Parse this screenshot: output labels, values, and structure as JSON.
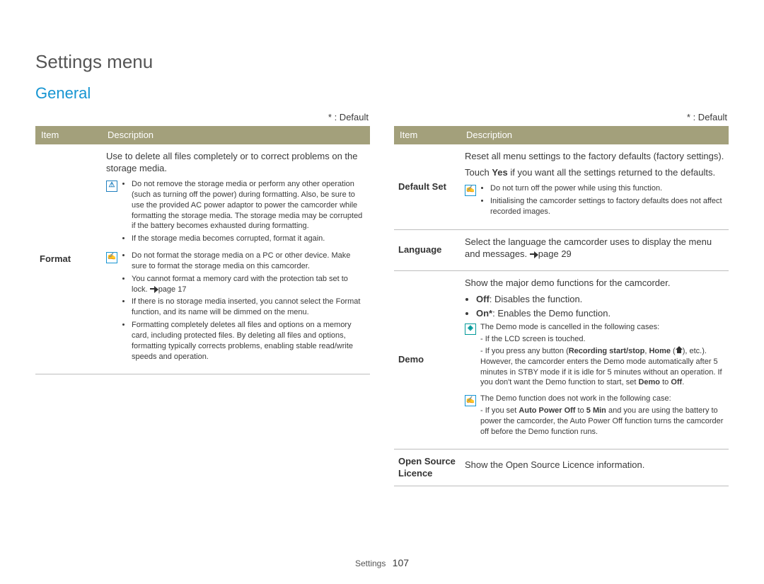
{
  "pageTitle": "Settings menu",
  "sectionHeading": "General",
  "defaultNote": "* : Default",
  "tableHeaders": {
    "item": "Item",
    "description": "Description"
  },
  "left": {
    "format": {
      "label": "Format",
      "intro": "Use to delete all files completely or to correct problems on the storage media.",
      "note1": {
        "b1": "Do not remove the storage media or perform any other operation (such as turning off the power) during formatting. Also, be sure to use the provided AC power adaptor to power the camcorder while formatting the storage media. The storage media may be corrupted if the battery becomes exhausted during formatting.",
        "b2": "If the storage media becomes corrupted, format it again."
      },
      "note2": {
        "b1": "Do not format the storage media on a PC or other device. Make sure to format the storage media on this camcorder.",
        "b2_pre": "You cannot format a memory card with the protection tab set to lock. ",
        "b2_page": "page 17",
        "b3": "If there is no storage media inserted, you cannot select the Format function, and its name will be dimmed on the menu.",
        "b4": "Formatting completely deletes all files and options on a memory card, including protected files. By deleting all files and options, formatting typically corrects problems, enabling stable read/write speeds and operation."
      }
    }
  },
  "right": {
    "defaultSet": {
      "label": "Default Set",
      "p1": "Reset all menu settings to the factory defaults (factory settings).",
      "p2_pre": "Touch ",
      "p2_b": "Yes",
      "p2_post": " if you want all the settings returned to the defaults.",
      "note": {
        "b1": "Do not turn off the power while using this function.",
        "b2": "Initialising the camcorder settings to factory defaults does not affect recorded images."
      }
    },
    "language": {
      "label": "Language",
      "text_pre": "Select the language the camcorder uses to display the menu and messages. ",
      "text_page": "page 29"
    },
    "demo": {
      "label": "Demo",
      "intro": "Show the major demo functions for the camcorder.",
      "off_b": "Off",
      "off_rest": ": Disables the function.",
      "on_b": "On*",
      "on_rest": ": Enables the Demo function.",
      "note1": {
        "l1": "The Demo mode is cancelled in the following cases:",
        "l2": "- If the LCD screen is touched.",
        "l3_pre": "- If you press any button (",
        "l3_b1": "Recording start/stop",
        "l3_mid": ", ",
        "l3_b2": "Home",
        "l3_post1": " (",
        "l3_post2": "), etc.). However, the camcorder enters the Demo mode automatically after 5 minutes in STBY mode if it is idle for 5 minutes without an operation. If you don't want the Demo function to start, set ",
        "l3_b3": "Demo",
        "l3_to": " to ",
        "l3_b4": "Off",
        "l3_end": "."
      },
      "note2": {
        "l1": "The Demo function does not work in the following case:",
        "l2_pre": "- If you set ",
        "l2_b1": "Auto Power Off",
        "l2_mid": " to ",
        "l2_b2": "5 Min",
        "l2_post": " and you are using the battery to power the camcorder, the Auto Power Off function turns the camcorder off before the Demo function runs."
      }
    },
    "openSource": {
      "label": "Open Source Licence",
      "text": "Show the Open Source Licence information."
    }
  },
  "footer": {
    "section": "Settings",
    "page": "107"
  }
}
